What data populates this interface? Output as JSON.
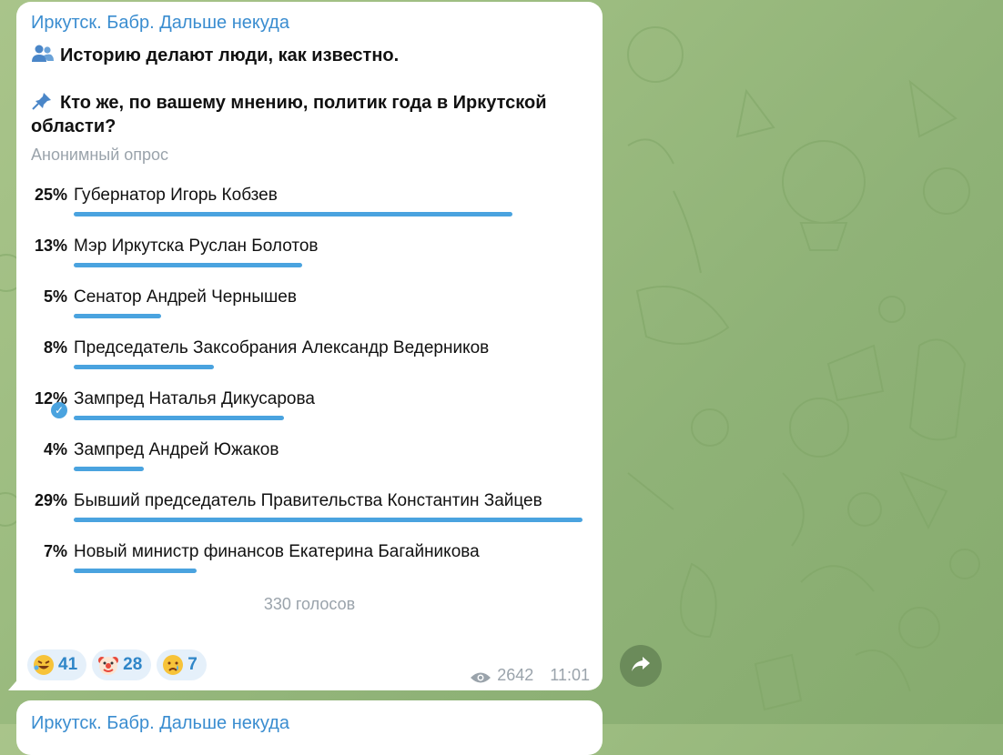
{
  "message": {
    "channel_name": "Иркутск. Бабр. Дальше некуда",
    "line1": "Историю делают люди, как известно.",
    "line2": "Кто же, по вашему мнению, политик года в Иркутской",
    "line3": "области?",
    "icons": {
      "line1": "people-icon",
      "line2": "pushpin-icon"
    }
  },
  "poll": {
    "type": "Анонимный опрос",
    "options": [
      {
        "percent": "25%",
        "text": "Губернатор Игорь Кобзев",
        "value": 25
      },
      {
        "percent": "13%",
        "text": "Мэр Иркутска Руслан Болотов",
        "value": 13
      },
      {
        "percent": "5%",
        "text": "Сенатор Андрей Чернышев",
        "value": 5
      },
      {
        "percent": "8%",
        "text": "Председатель Заксобрания Александр Ведерников",
        "value": 8
      },
      {
        "percent": "12%",
        "text": "Зампред Наталья Дикусарова",
        "value": 12,
        "chosen": true
      },
      {
        "percent": "4%",
        "text": "Зампред Андрей Южаков",
        "value": 4
      },
      {
        "percent": "29%",
        "text": "Бывший председатель Правительства Константин Зайцев",
        "value": 29
      },
      {
        "percent": "7%",
        "text": "Новый министр финансов Екатерина Багайникова",
        "value": 7
      }
    ],
    "votes": "330 голосов"
  },
  "reactions": [
    {
      "icon": "rofl-emoji-icon",
      "count": "41"
    },
    {
      "icon": "clown-emoji-icon",
      "count": "28"
    },
    {
      "icon": "crying-emoji-icon",
      "count": "7"
    }
  ],
  "meta": {
    "views": "2642",
    "time": "11:01"
  },
  "next_message": {
    "channel_name": "Иркутск. Бабр. Дальше некуда"
  },
  "colors": {
    "accent": "#4aa3df",
    "link": "#3a8dd0",
    "muted": "#9aa3ab"
  }
}
